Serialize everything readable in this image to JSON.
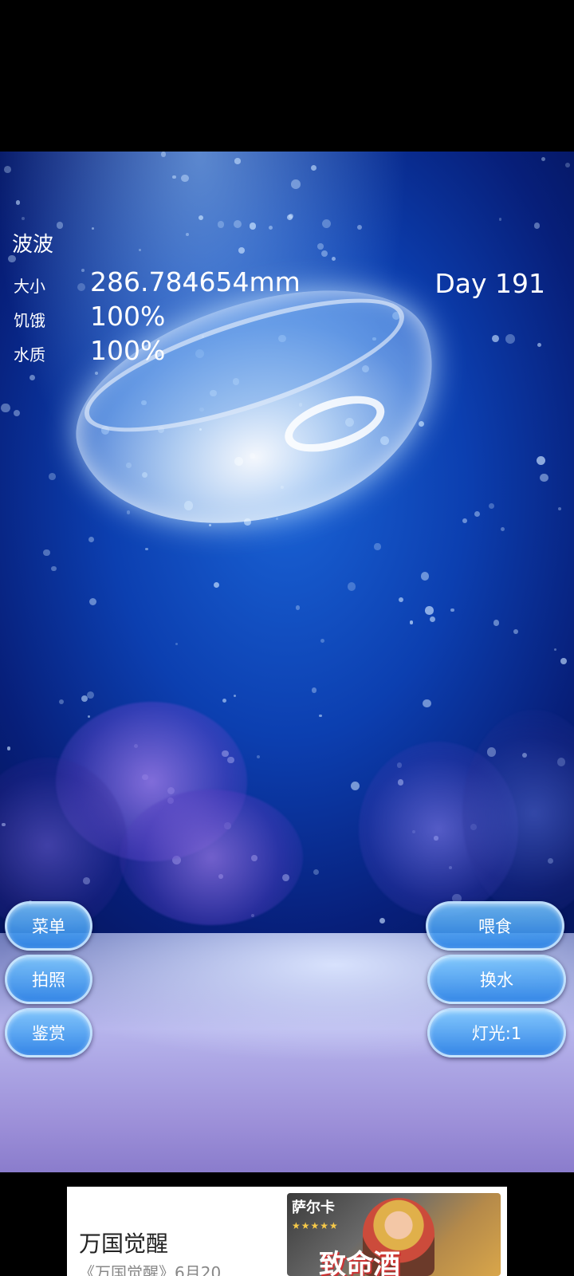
{
  "pet": {
    "name": "波波",
    "day": "Day 191",
    "stats": [
      {
        "label": "大小",
        "value": "286.784654mm"
      },
      {
        "label": "饥饿",
        "value": "100%"
      },
      {
        "label": "水质",
        "value": "100%"
      }
    ]
  },
  "left_buttons": {
    "menu": "菜单",
    "photo": "拍照",
    "appreciate": "鉴赏"
  },
  "right_buttons": {
    "feed": "喂食",
    "change_water": "换水",
    "light": "灯光:1"
  },
  "ad": {
    "title": "万国觉醒",
    "description": "《万国觉醒》6月20...",
    "image_title": "萨尔卡",
    "image_stars": "★★★★★",
    "image_text": "致命酒"
  },
  "colors": {
    "water_deep": "#071f7a",
    "water_light": "#1a63d6",
    "button": "#2882e6"
  }
}
